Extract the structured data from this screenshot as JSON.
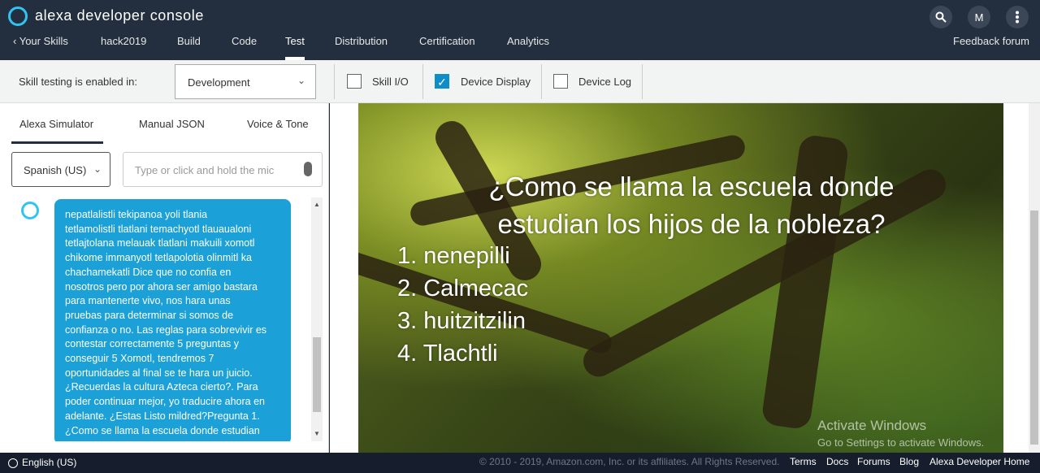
{
  "header": {
    "brand": "alexa developer console",
    "avatar_letter": "M",
    "nav": [
      {
        "label": "Your Skills"
      },
      {
        "label": "hack2019"
      },
      {
        "label": "Build"
      },
      {
        "label": "Code"
      },
      {
        "label": "Test"
      },
      {
        "label": "Distribution"
      },
      {
        "label": "Certification"
      },
      {
        "label": "Analytics"
      }
    ],
    "feedback": "Feedback forum"
  },
  "toolbar": {
    "label": "Skill testing is enabled in:",
    "stage": "Development",
    "checks": [
      {
        "label": "Skill I/O",
        "checked": false
      },
      {
        "label": "Device Display",
        "checked": true
      },
      {
        "label": "Device Log",
        "checked": false
      }
    ]
  },
  "simulator": {
    "tabs": [
      "Alexa Simulator",
      "Manual JSON",
      "Voice & Tone"
    ],
    "language": "Spanish (US)",
    "input_placeholder": "Type or click and hold the mic",
    "message": "nepatlalistli tekipanoa yoli tlania\ntetlamolistli tlatlani temachyotl tlauaualoni\ntetlajtolana melauak tlatlani makuili xomotl\nchikome immanyotl tetlapolotia olinmitl ka\nchachamekatli Dice que no confia en\nnosotros pero por ahora ser amigo bastara\npara mantenerte vivo, nos hara unas\npruebas para determinar si somos de\nconfianza o no. Las reglas para sobrevivir es\ncontestar correctamente 5 preguntas y\nconseguir 5 Xomotl, tendremos 7\noportunidades al final se te hara un juicio.\n¿Recuerdas la cultura Azteca cierto?. Para\npoder continuar mejor, yo traducire ahora en\nadelante. ¿Estas Listo mildred?Pregunta 1.\n¿Como se llama la escuela donde estudian"
  },
  "display": {
    "question_line1": "¿Como se llama la escuela donde",
    "question_line2": "estudian los hijos de la nobleza?",
    "options": [
      "1. nenepilli",
      "2. Calmecac",
      "3. huitzitzilin",
      "4. Tlachtli"
    ],
    "watermark_title": "Activate Windows",
    "watermark_sub": "Go to Settings to activate Windows."
  },
  "footer": {
    "language": "English (US)",
    "copyright": "© 2010 - 2019, Amazon.com, Inc. or its affiliates. All Rights Reserved.",
    "links": [
      "Terms",
      "Docs",
      "Forums",
      "Blog",
      "Alexa Developer Home"
    ]
  },
  "colors": {
    "accent": "#31c4f3",
    "bubble": "#1ba0d7",
    "header": "#232f3e",
    "check": "#0e8dc9"
  },
  "icons": {
    "search": "search-icon",
    "more": "more-vertical-icon",
    "mic": "mic-icon",
    "globe": "globe-icon"
  }
}
